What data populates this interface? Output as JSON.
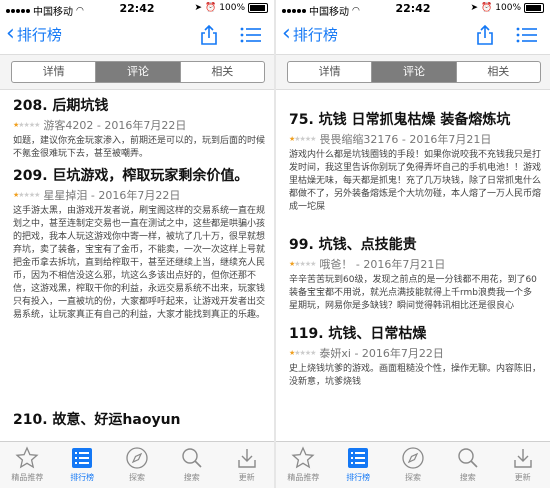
{
  "status": {
    "carrier": "中国移动",
    "time": "22:42",
    "battery": "100%"
  },
  "nav": {
    "back_label": "排行榜"
  },
  "segments": [
    "详情",
    "评论",
    "相关"
  ],
  "colors": {
    "accent": "#1478f5",
    "star_on": "#f0a020"
  },
  "left": {
    "reviews": [
      {
        "title": "208. 后期坑钱",
        "stars": 1,
        "author": "游客4202 - 2016年7月22日",
        "body": "如题，建议你充金玩家渗入，前期还是可以的，玩到后面的时候不氪金很难玩下去，甚至被嘲弄。"
      },
      {
        "title": "209. 巨坑游戏，榨取玩家剩余价值。",
        "stars": 1,
        "author": "星星掉泪 - 2016年7月22日",
        "body": "这手游太黑，由游戏开发者说，刷宝阁这样的交易系统一直在规划之中，甚至连制定交易也一直在测试之中，这些都是哄骗小孩的把戏，我本人玩这游戏你中寄一样，被坑了几十万，很早就想弃坑，卖了装备，宝宝有了金币，不能卖，一次一次这样上号就把金币拿去拆坑，直到给榨取干，甚至还继续上当，继续充人民币，因为不相信没这么邪，坑这么多该出点好的，但你还那不信，这游戏黑，榨取干你的利益，永远交易系统不出来，玩家钱只有投入，一直被坑的份，大家都呼吁起来，让游戏开发者出交易系统，让玩家真正有自己的利益，大家才能找到真正的乐趣。"
      },
      {
        "title": "210. 故意、好运haoyun",
        "stars": 1,
        "author": "",
        "body": ""
      }
    ]
  },
  "right": {
    "reviews": [
      {
        "title": "75. 坑钱  日常抓鬼枯燥  装备熔炼坑",
        "stars": 1,
        "author": "畏畏缩缩32176 - 2016年7月21日",
        "body": "游戏内什么都是坑钱圈钱的手段！如果你说咬我不充钱我只是打发时间，我这里告诉你别玩了免得弄坏自己的手机电池！！游戏里枯燥无味，每天都是抓鬼！充了几万块钱，除了日常抓鬼什么都做不了，另外装备熔炼是个大坑勿碰，本人熔了一万人民币熔成一坨屎"
      },
      {
        "title": "99. 坑钱、点技能贵",
        "stars": 1,
        "author": "哦爸！ - 2016年7月21日",
        "body": "辛辛苦苦玩到60级，发现之前点的是一分钱都不用花，到了60装备宝宝都不用说，就光点满技能就得上千rmb浪费我一个多星期玩，网易你是多缺钱？瞬间觉得韩讯相比还是很良心"
      },
      {
        "title": "119. 坑钱、日常枯燥",
        "stars": 1,
        "author": "泰妍xi - 2016年7月22日",
        "body": "史上烧钱坑爹的游戏。画面粗糙没个性，操作无聊。内容陈旧，没新意，坑爹烧钱"
      }
    ]
  },
  "tabs": [
    {
      "label": "精品推荐",
      "icon": "star-icon",
      "active": false
    },
    {
      "label": "排行榜",
      "icon": "ranking-list-icon",
      "active": true
    },
    {
      "label": "探索",
      "icon": "compass-icon",
      "active": false
    },
    {
      "label": "搜索",
      "icon": "search-icon",
      "active": false
    },
    {
      "label": "更新",
      "icon": "download-icon",
      "active": false
    }
  ]
}
